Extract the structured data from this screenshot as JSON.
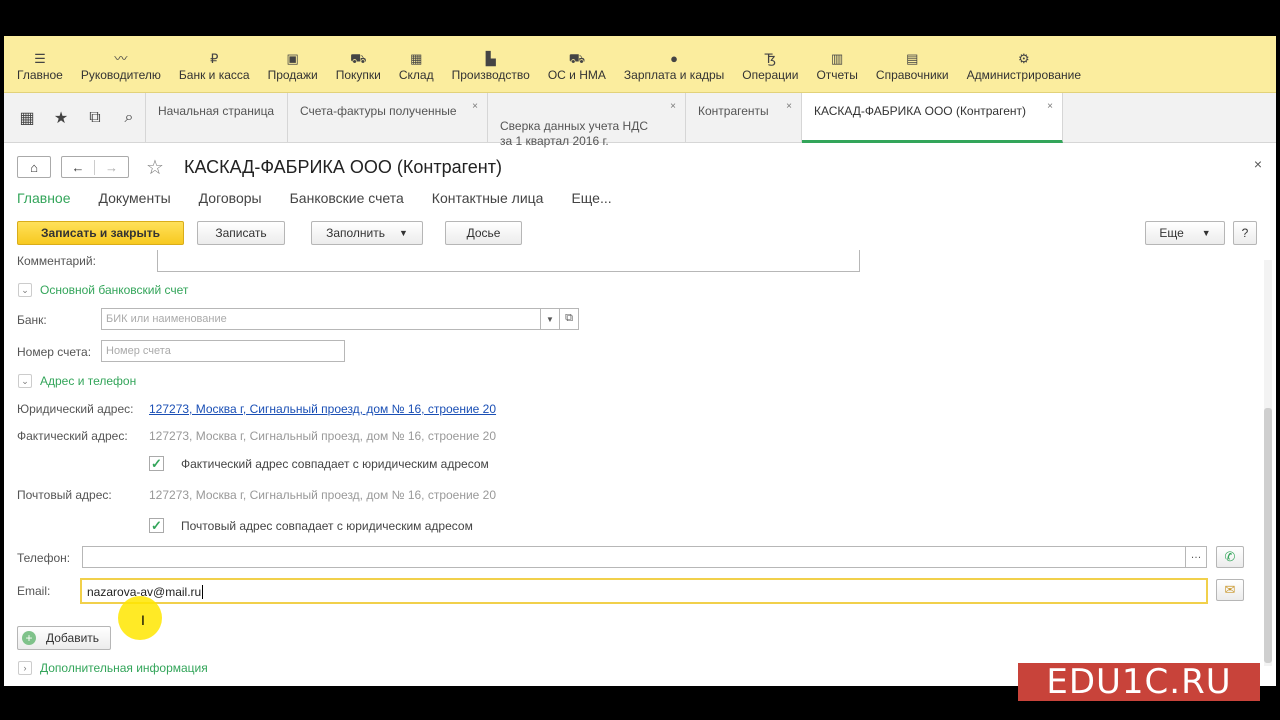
{
  "sections": [
    {
      "label": "Главное",
      "icon": "menu-icon",
      "glyph": "☰"
    },
    {
      "label": "Руководителю",
      "icon": "chart-line-icon",
      "glyph": "〰"
    },
    {
      "label": "Банк и касса",
      "icon": "coin-icon",
      "glyph": "₽"
    },
    {
      "label": "Продажи",
      "icon": "shopping-bag-icon",
      "glyph": "▣"
    },
    {
      "label": "Покупки",
      "icon": "cart-icon",
      "glyph": "⛟"
    },
    {
      "label": "Склад",
      "icon": "warehouse-icon",
      "glyph": "▦"
    },
    {
      "label": "Производство",
      "icon": "factory-icon",
      "glyph": "▙"
    },
    {
      "label": "ОС и НМА",
      "icon": "truck-icon",
      "glyph": "⛟"
    },
    {
      "label": "Зарплата и кадры",
      "icon": "person-icon",
      "glyph": "●"
    },
    {
      "label": "Операции",
      "icon": "operations-icon",
      "glyph": "Ꜩ"
    },
    {
      "label": "Отчеты",
      "icon": "bar-chart-icon",
      "glyph": "▥"
    },
    {
      "label": "Справочники",
      "icon": "book-icon",
      "glyph": "▤"
    },
    {
      "label": "Администрирование",
      "icon": "gear-icon",
      "glyph": "⚙"
    }
  ],
  "tabs": [
    {
      "label": "Начальная страница"
    },
    {
      "label": "Счета-фактуры полученные"
    },
    {
      "label": "Сверка данных учета НДС\nза 1 квартал 2016 г."
    },
    {
      "label": "Контрагенты"
    },
    {
      "label": "КАСКАД-ФАБРИКА ООО (Контрагент)"
    }
  ],
  "form": {
    "title": "КАСКАД-ФАБРИКА ООО (Контрагент)",
    "tabs": [
      "Главное",
      "Документы",
      "Договоры",
      "Банковские счета",
      "Контактные лица",
      "Еще..."
    ],
    "buttons": {
      "save_close": "Записать и закрыть",
      "save": "Записать",
      "fill": "Заполнить",
      "dossier": "Досье",
      "more": "Еще",
      "help": "?"
    },
    "comment_label": "Комментарий:",
    "bank_group": "Основной банковский счет",
    "bank_label": "Банк:",
    "bank_placeholder": "БИК или наименование",
    "account_label": "Номер счета:",
    "account_placeholder": "Номер счета",
    "address_group": "Адрес и телефон",
    "legal_label": "Юридический адрес:",
    "legal_value": "127273, Москва г, Сигнальный проезд, дом № 16, строение 20",
    "actual_label": "Фактический адрес:",
    "actual_value": "127273, Москва г, Сигнальный проезд, дом № 16, строение 20",
    "actual_same": "Фактический адрес совпадает с юридическим адресом",
    "postal_label": "Почтовый адрес:",
    "postal_value": "127273, Москва г, Сигнальный проезд, дом № 16, строение 20",
    "postal_same": "Почтовый адрес совпадает с юридическим адресом",
    "phone_label": "Телефон:",
    "email_label": "Email:",
    "email_value": "nazarova-av@mail.ru",
    "add_button": "Добавить",
    "extra_group": "Дополнительная информация"
  },
  "watermark": "EDU1C.RU",
  "colors": {
    "section_bar": "#fbed9e",
    "accent_green": "#33a55a",
    "primary_button": "#f7c920"
  }
}
